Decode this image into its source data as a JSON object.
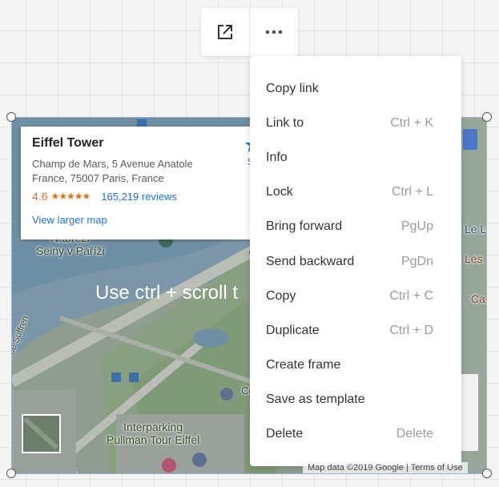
{
  "toolbar": {
    "open_icon": "open-external-icon",
    "more_icon": "more-horizontal-icon"
  },
  "map": {
    "scroll_hint": "Use ctrl + scroll t",
    "labels": {
      "neighborhood": "Nábřeží\nSeiny v Paříži",
      "street": "Avenue de Suffren",
      "parking": "Interparking\nPullman Tour Eiffel",
      "right_la": "Le La",
      "right_les": "Les",
      "right_ca": "Ca",
      "right_co": "Co"
    },
    "attribution": "Map data ©2019 Google  |  Terms of Use"
  },
  "info_card": {
    "title": "Eiffel Tower",
    "address": "Champ de Mars, 5 Avenue Anatole France, 75007 Paris, France",
    "rating": "4.6",
    "stars": "★★★★★",
    "reviews": "165,219 reviews",
    "view_larger": "View larger map",
    "save_label": "Sa"
  },
  "context_menu": {
    "items": [
      {
        "label": "Copy link",
        "shortcut": ""
      },
      {
        "label": "Link to",
        "shortcut": "Ctrl + K"
      },
      {
        "label": "Info",
        "shortcut": ""
      },
      {
        "label": "Lock",
        "shortcut": "Ctrl + L"
      },
      {
        "label": "Bring forward",
        "shortcut": "PgUp"
      },
      {
        "label": "Send backward",
        "shortcut": "PgDn"
      },
      {
        "label": "Copy",
        "shortcut": "Ctrl + C"
      },
      {
        "label": "Duplicate",
        "shortcut": "Ctrl + D"
      },
      {
        "label": "Create frame",
        "shortcut": ""
      },
      {
        "label": "Save as template",
        "shortcut": ""
      },
      {
        "label": "Delete",
        "shortcut": "Delete"
      }
    ]
  },
  "colors": {
    "accent": "#1a73e8",
    "rating": "#e7711b",
    "selection": "#9fb3d9"
  }
}
